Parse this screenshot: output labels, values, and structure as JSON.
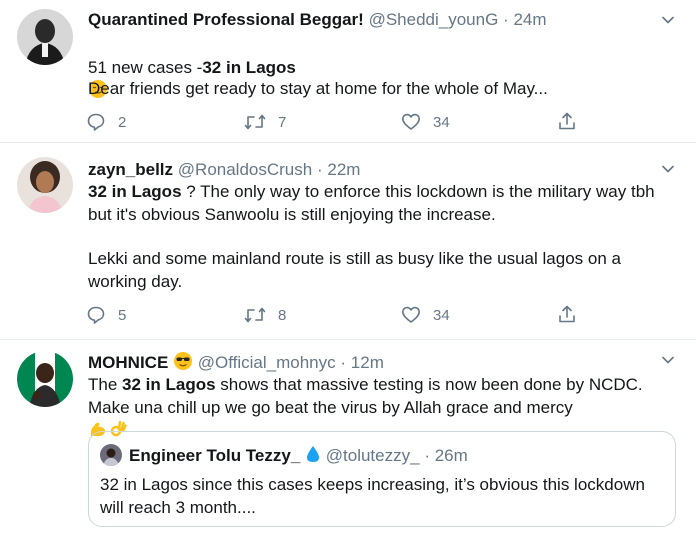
{
  "tweets": [
    {
      "name": "Quarantined Professional Beggar!",
      "handle": "@Sheddi_younG",
      "time": "24m",
      "text_pre": "51 new cases -",
      "text_bold": "32 in Lagos",
      "text_line2": "Dear friends get ready to stay at home for the whole of May...",
      "replies": "2",
      "retweets": "7",
      "likes": "34"
    },
    {
      "name": "zayn_bellz",
      "handle": "@RonaldosCrush",
      "time": "22m",
      "text_bold": "32 in Lagos",
      "text_rest": " ? The only way to enforce this lockdown is the military way tbh but it's obvious Sanwoolu is still enjoying the increase.",
      "text_para2": "Lekki and some mainland route is still as busy like the usual lagos on a working day.",
      "replies": "5",
      "retweets": "8",
      "likes": "34"
    },
    {
      "name": "MOHNICE",
      "handle": "@Official_mohnyc",
      "time": "12m",
      "text_pre": "The ",
      "text_bold": "32 in Lagos",
      "text_rest": " shows that massive testing is now been done by NCDC. Make una chill up we go beat the virus by Allah grace and mercy",
      "quote": {
        "name": "Engineer Tolu Tezzy_",
        "handle": "@tolutezzy_",
        "time": "26m",
        "text": "32 in Lagos since this cases keeps increasing,  it’s obvious this lockdown will reach 3 month...."
      }
    }
  ],
  "icons": {
    "reply": "reply-icon",
    "retweet": "retweet-icon",
    "like": "heart-icon",
    "share": "share-icon",
    "more": "chevron-down-icon"
  },
  "colors": {
    "text": "#14171a",
    "secondary": "#657786",
    "border": "#e6ecf0",
    "verified_drop": "#1da1f2"
  },
  "separator": "·"
}
